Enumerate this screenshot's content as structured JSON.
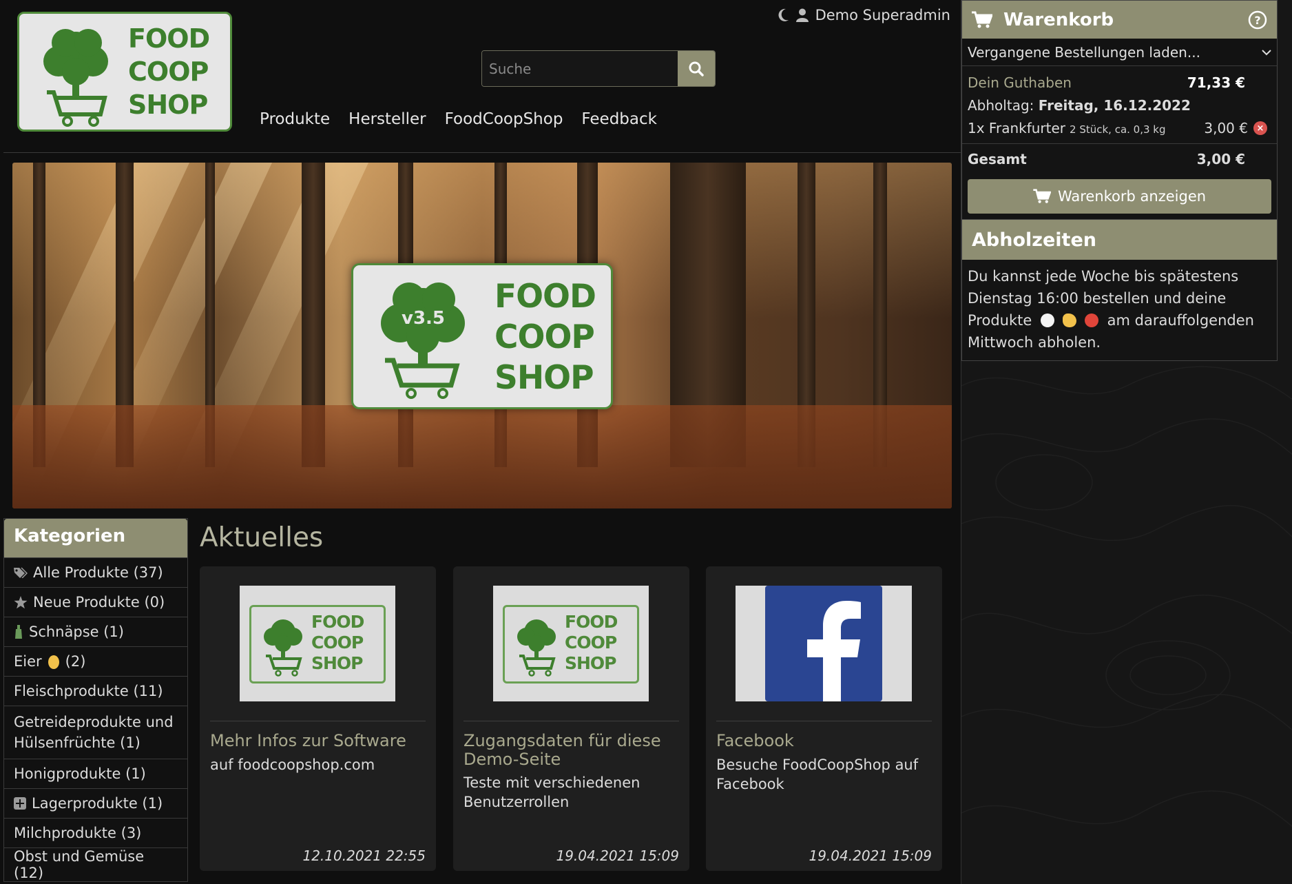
{
  "header": {
    "logo_lines": [
      "FOOD",
      "COOP",
      "SHOP"
    ],
    "user_name": "Demo Superadmin",
    "search_placeholder": "Suche",
    "nav": [
      "Produkte",
      "Hersteller",
      "FoodCoopShop",
      "Feedback"
    ]
  },
  "banner": {
    "version": "v3.5",
    "logo_lines": [
      "FOOD",
      "COOP",
      "SHOP"
    ]
  },
  "categories": {
    "title": "Kategorien",
    "items": [
      {
        "label": "Alle Produkte (37)",
        "icon": "tags-icon"
      },
      {
        "label": "Neue Produkte (0)",
        "icon": "star-icon"
      },
      {
        "label": "Schnäpse (1)",
        "icon": "bottle-icon"
      },
      {
        "label": "Eier",
        "count": "(2)",
        "icon": "egg-icon"
      },
      {
        "label": "Fleischprodukte (11)"
      },
      {
        "label": "Getreideprodukte und Hülsenfrüchte (1)"
      },
      {
        "label": "Honigprodukte (1)"
      },
      {
        "label": "Lagerprodukte (1)",
        "icon": "plus-square-icon"
      },
      {
        "label": "Milchprodukte (3)"
      },
      {
        "label": "Obst und Gemüse (12)"
      }
    ]
  },
  "news": {
    "title": "Aktuelles",
    "cards": [
      {
        "title": "Mehr Infos zur Software",
        "text": "auf foodcoopshop.com",
        "date": "12.10.2021 22:55",
        "image": "foodcoopshop-logo",
        "logo_lines": [
          "FOOD",
          "COOP",
          "SHOP"
        ]
      },
      {
        "title": "Zugangsdaten für diese Demo-Seite",
        "text": "Teste mit verschiedenen Benutzerrollen",
        "date": "19.04.2021 15:09",
        "image": "foodcoopshop-logo",
        "logo_lines": [
          "FOOD",
          "COOP",
          "SHOP"
        ]
      },
      {
        "title": "Facebook",
        "text": "Besuche FoodCoopShop auf Facebook",
        "date": "19.04.2021 15:09",
        "image": "facebook-logo"
      }
    ]
  },
  "cart": {
    "title": "Warenkorb",
    "past_orders": "Vergangene Bestellungen laden...",
    "credit_label": "Dein Guthaben",
    "credit_value": "71,33 €",
    "pickup_label": "Abholtag:",
    "pickup_value": "Freitag, 16.12.2022",
    "item_name": "1x Frankfurter",
    "item_unit": "2 Stück, ca. 0,3 kg",
    "item_price": "3,00 €",
    "total_label": "Gesamt",
    "total_value": "3,00 €",
    "show_cart": "Warenkorb anzeigen"
  },
  "pickup": {
    "title": "Abholzeiten",
    "text_part1": "Du kannst jede Woche bis spätestens Dienstag 16:00 bestellen und deine Produkte",
    "text_part2": "am darauffolgenden Mittwoch abholen."
  },
  "colors": {
    "accent": "#8e8e72",
    "background": "#0f0f0f",
    "logo_green": "#3d7f2d",
    "facebook_blue": "#2a4592",
    "remove_red": "#d9534f"
  }
}
